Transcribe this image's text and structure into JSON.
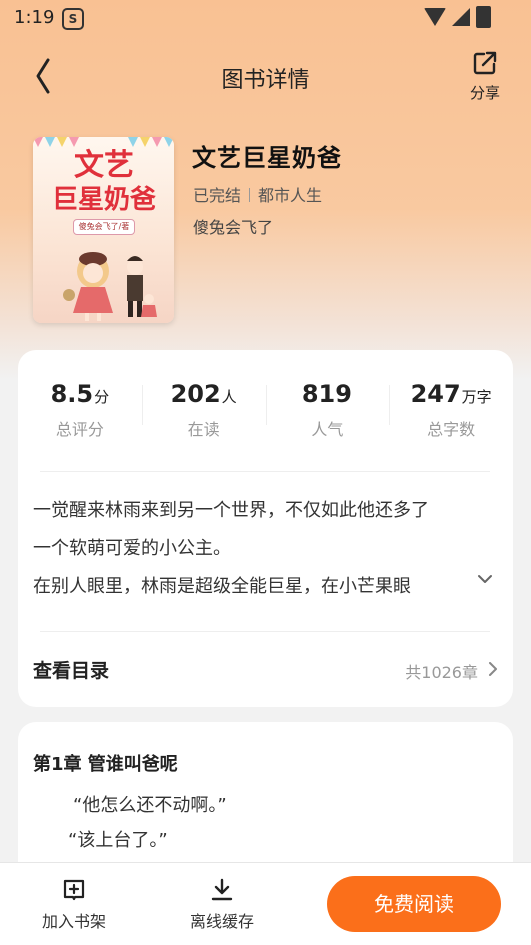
{
  "status_bar": {
    "time": "1:19",
    "app_badge": "S"
  },
  "nav": {
    "title": "图书详情",
    "share_label": "分享"
  },
  "book": {
    "title": "文艺巨星奶爸",
    "status": "已完结",
    "category": "都市人生",
    "author": "傻兔会飞了",
    "cover": {
      "title_line1": "文艺",
      "title_line2": "巨星奶爸",
      "author_tag": "傻兔会飞了/著"
    }
  },
  "stats": [
    {
      "value": "8.5",
      "unit": "分",
      "label": "总评分"
    },
    {
      "value": "202",
      "unit": "人",
      "label": "在读"
    },
    {
      "value": "819",
      "unit": "",
      "label": "人气"
    },
    {
      "value": "247",
      "unit": "万字",
      "label": "总字数"
    }
  ],
  "description": [
    "一觉醒来林雨来到另一个世界，不仅如此他还多了",
    "一个软萌可爱的小公主。",
    "在别人眼里，林雨是超级全能巨星，在小芒果眼"
  ],
  "toc": {
    "label": "查看目录",
    "count": "共1026章"
  },
  "chapter": {
    "title": "第1章 管谁叫爸呢",
    "lines": [
      "“他怎么还不动啊。”",
      "“该上台了。”"
    ]
  },
  "bottom_bar": {
    "add_shelf": "加入书架",
    "offline": "离线缓存",
    "read": "免费阅读"
  },
  "colors": {
    "accent": "#fb6f1a",
    "hero": "#f9c193"
  },
  "icons": [
    "back-icon",
    "share-icon",
    "expand-icon",
    "chevron-right-icon",
    "bookshelf-add-icon",
    "download-icon"
  ]
}
